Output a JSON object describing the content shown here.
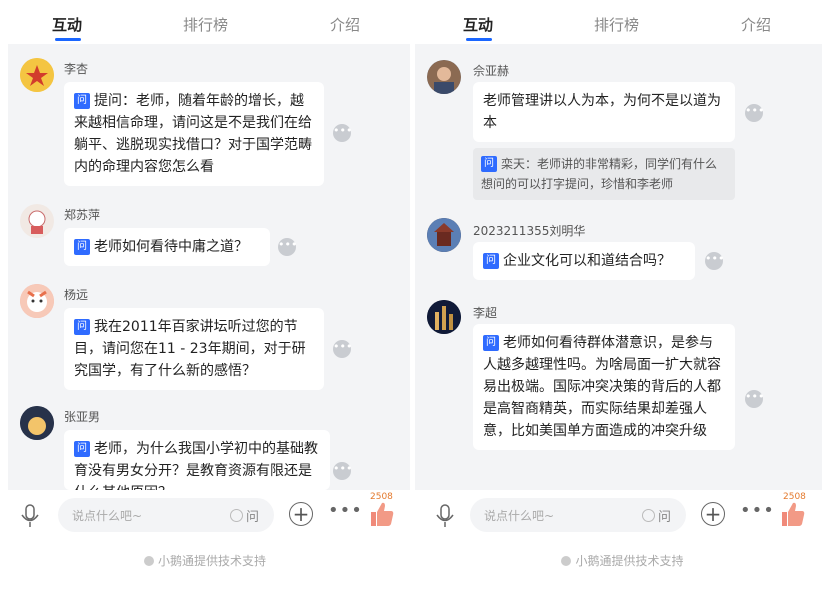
{
  "left": {
    "tabs": [
      "互动",
      "排行榜",
      "介绍"
    ],
    "messages": [
      {
        "name": "李杏",
        "tag": "问",
        "text": "提问：老师，随着年龄的增长，越来越相信命理，请问这是不是我们在给躺平、逃脱现实找借口？对于国学范畴内的命理内容您怎么看"
      },
      {
        "name": "郑苏萍",
        "tag": "问",
        "text": "老师如何看待中庸之道？"
      },
      {
        "name": "杨远",
        "tag": "问",
        "text": "我在2011年百家讲坛听过您的节目，请问您在11 - 23年期间，对于研究国学，有了什么新的感悟？"
      },
      {
        "name": "张亚男",
        "tag": "问",
        "text": "老师，为什么我国小学初中的基础教育没有男女分开？是教育资源有限还是什么其他原因？"
      }
    ],
    "input_placeholder": "说点什么吧~",
    "ask_label": "问",
    "like_count": "2508",
    "footer": "小鹅通提供技术支持"
  },
  "right": {
    "tabs": [
      "互动",
      "排行榜",
      "介绍"
    ],
    "messages": [
      {
        "name": "佘亚赫",
        "text": "老师管理讲以人为本，为何不是以道为本",
        "reply_tag": "问",
        "reply": "栾天：老师讲的非常精彩，同学们有什么想问的可以打字提问，珍惜和李老师"
      },
      {
        "name": "2023211355刘明华",
        "tag": "问",
        "text": "企业文化可以和道结合吗？"
      },
      {
        "name": "李超",
        "tag": "问",
        "text": "老师如何看待群体潜意识，是参与人越多越理性吗。为啥局面一扩大就容易出极端。国际冲突决策的背后的人都是高智商精英，而实际结果却差强人意，比如美国单方面造成的冲突升级"
      }
    ],
    "input_placeholder": "说点什么吧~",
    "ask_label": "问",
    "like_count": "2508",
    "footer": "小鹅通提供技术支持"
  },
  "colors": {
    "accent": "#1a66ff",
    "tag": "#2f6bff",
    "feed_bg": "#f3f4f6",
    "like": "#f08a7a"
  },
  "icons": [
    "microphone-icon",
    "plus-circle-icon",
    "more-dots-icon",
    "thumbs-up-icon",
    "more-options-icon"
  ]
}
